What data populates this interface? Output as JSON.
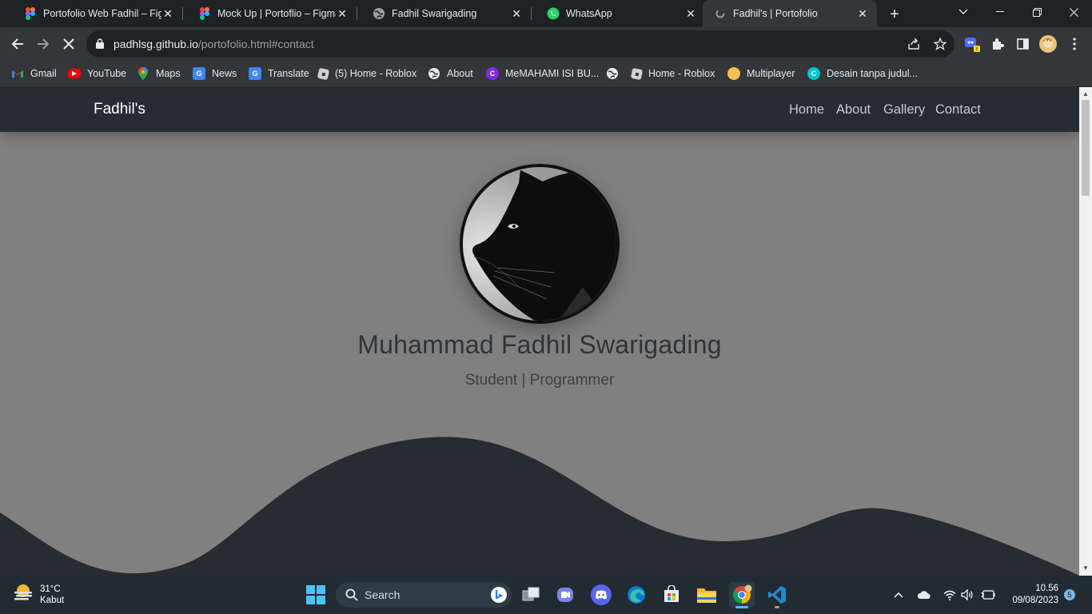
{
  "browser": {
    "tabs": [
      {
        "title": "Portofolio Web Fadhil – Figma",
        "icon": "figma-icon"
      },
      {
        "title": "Mock Up | Portoflio – Figma",
        "icon": "figma-icon"
      },
      {
        "title": "Fadhil Swarigading",
        "icon": "globe-icon"
      },
      {
        "title": "WhatsApp",
        "icon": "whatsapp-icon"
      },
      {
        "title": "Fadhil's | Portofolio",
        "icon": "loading-icon",
        "active": true
      }
    ],
    "url_host": "padhlsg.github.io",
    "url_path": "/portofolio.html#contact",
    "bookmarks": [
      {
        "label": "Gmail",
        "icon": "gmail-icon"
      },
      {
        "label": "YouTube",
        "icon": "youtube-icon"
      },
      {
        "label": "Maps",
        "icon": "maps-icon"
      },
      {
        "label": "News",
        "icon": "news-icon"
      },
      {
        "label": "Translate",
        "icon": "translate-icon"
      },
      {
        "label": "(5) Home - Roblox",
        "icon": "roblox-icon"
      },
      {
        "label": "About",
        "icon": "globe-icon"
      },
      {
        "label": "MeMAHAMI ISI BU...",
        "icon": "canva-icon"
      },
      {
        "label": "",
        "icon": "globe-icon"
      },
      {
        "label": "Home - Roblox",
        "icon": "roblox-icon"
      },
      {
        "label": "Multiplayer",
        "icon": "multiplayer-icon"
      },
      {
        "label": "Desain tanpa judul...",
        "icon": "canva-icon"
      }
    ]
  },
  "site": {
    "brand": "Fadhil's",
    "nav": [
      "Home",
      "About",
      "Gallery",
      "Contact"
    ],
    "name": "Muhammad Fadhil Swarigading",
    "subtitle": "Student | Programmer",
    "colors": {
      "navbar": "#272c33",
      "hero_bg": "#808080",
      "wave": "#272c33"
    }
  },
  "taskbar": {
    "weather_temp": "31°C",
    "weather_desc": "Kabut",
    "search_placeholder": "Search",
    "time": "10.56",
    "date": "09/08/2023",
    "notifications": "5"
  }
}
